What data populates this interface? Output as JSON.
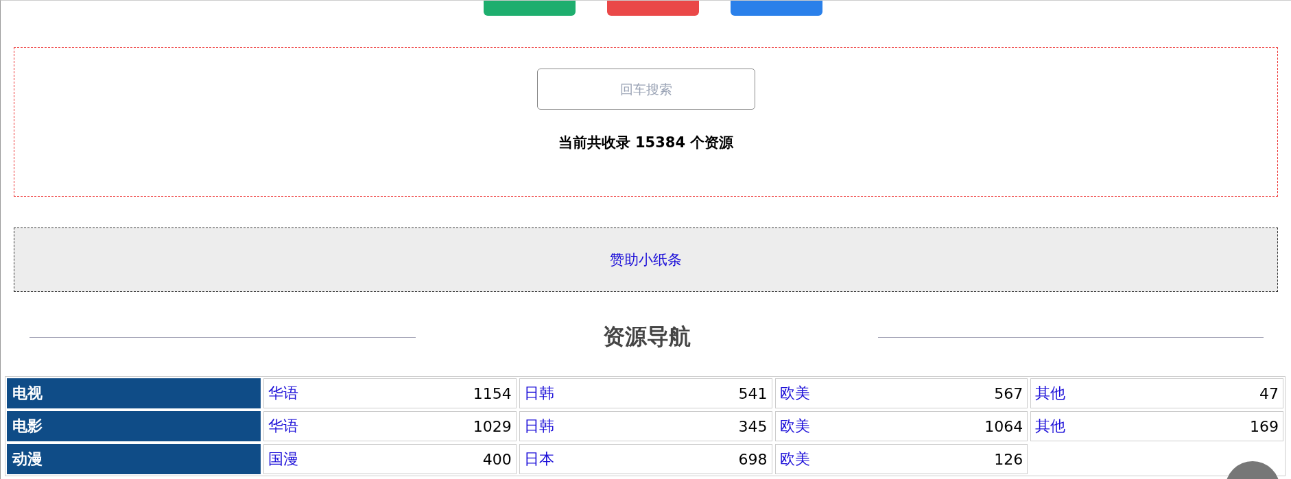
{
  "top_buttons": [
    {
      "color": "#1eae6e"
    },
    {
      "color": "#ea4848"
    },
    {
      "color": "#2a80ea"
    }
  ],
  "search": {
    "placeholder": "回车搜索"
  },
  "count_text": "当前共收录 15384 个资源",
  "sponsor_link": "赞助小纸条",
  "nav_title": "资源导航",
  "nav_rows": [
    {
      "category": "电视",
      "items": [
        {
          "label": "华语",
          "count": "1154"
        },
        {
          "label": "日韩",
          "count": "541"
        },
        {
          "label": "欧美",
          "count": "567"
        },
        {
          "label": "其他",
          "count": "47"
        }
      ]
    },
    {
      "category": "电影",
      "items": [
        {
          "label": "华语",
          "count": "1029"
        },
        {
          "label": "日韩",
          "count": "345"
        },
        {
          "label": "欧美",
          "count": "1064"
        },
        {
          "label": "其他",
          "count": "169"
        }
      ]
    },
    {
      "category": "动漫",
      "items": [
        {
          "label": "国漫",
          "count": "400"
        },
        {
          "label": "日本",
          "count": "698"
        },
        {
          "label": "欧美",
          "count": "126"
        }
      ]
    }
  ]
}
